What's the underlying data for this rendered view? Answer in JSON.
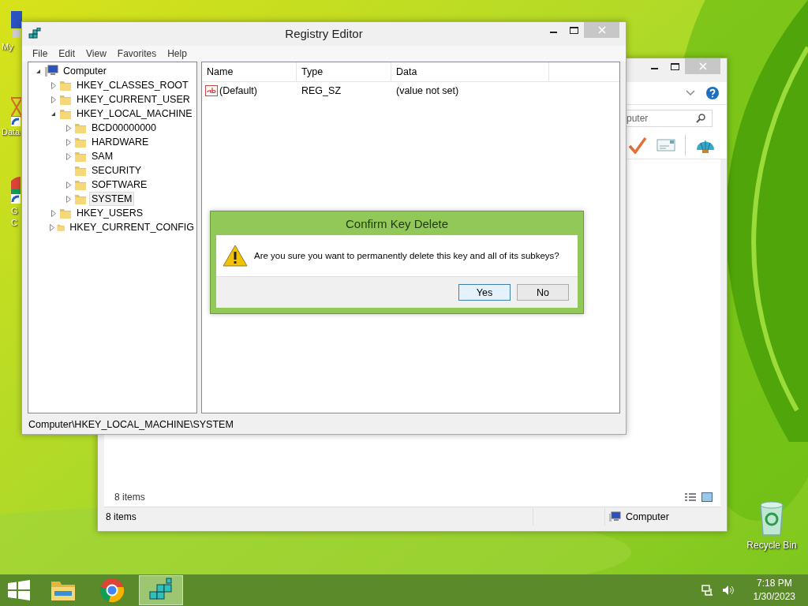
{
  "desktop_icons": [
    {
      "kind": "computer",
      "lines": [
        "My"
      ]
    },
    {
      "kind": "data",
      "lines": [
        "Data"
      ]
    },
    {
      "kind": "chrome",
      "lines": [
        "G",
        "C"
      ]
    }
  ],
  "recycle_bin": {
    "label": "Recycle Bin"
  },
  "explorer": {
    "search": {
      "value": "puter"
    },
    "item_count": "8 items",
    "status": {
      "count": "8 items",
      "location": "Computer"
    }
  },
  "registry_editor": {
    "title": "Registry Editor",
    "menu": [
      "File",
      "Edit",
      "View",
      "Favorites",
      "Help"
    ],
    "tree": [
      {
        "label": "Computer",
        "kind": "computer",
        "expanded": true,
        "selected": false,
        "children": [
          {
            "label": "HKEY_CLASSES_ROOT",
            "kind": "folder",
            "expanded": false,
            "selected": false
          },
          {
            "label": "HKEY_CURRENT_USER",
            "kind": "folder",
            "expanded": false,
            "selected": false
          },
          {
            "label": "HKEY_LOCAL_MACHINE",
            "kind": "folder",
            "expanded": true,
            "selected": false,
            "children": [
              {
                "label": "BCD00000000",
                "kind": "folder",
                "expanded": false,
                "selected": false
              },
              {
                "label": "HARDWARE",
                "kind": "folder",
                "expanded": false,
                "selected": false
              },
              {
                "label": "SAM",
                "kind": "folder",
                "expanded": false,
                "selected": false
              },
              {
                "label": "SECURITY",
                "kind": "folder",
                "selected": false
              },
              {
                "label": "SOFTWARE",
                "kind": "folder",
                "expanded": false,
                "selected": false
              },
              {
                "label": "SYSTEM",
                "kind": "folder",
                "expanded": false,
                "selected": true
              }
            ]
          },
          {
            "label": "HKEY_USERS",
            "kind": "folder",
            "expanded": false,
            "selected": false
          },
          {
            "label": "HKEY_CURRENT_CONFIG",
            "kind": "folder",
            "expanded": false,
            "selected": false
          }
        ]
      }
    ],
    "columns": [
      "Name",
      "Type",
      "Data"
    ],
    "rows": [
      {
        "name": "(Default)",
        "type": "REG_SZ",
        "data": "(value not set)"
      }
    ],
    "status_bar": "Computer\\HKEY_LOCAL_MACHINE\\SYSTEM"
  },
  "dialog": {
    "title": "Confirm Key Delete",
    "message": "Are you sure you want to permanently delete this key and all of its subkeys?",
    "buttons": [
      {
        "label": "Yes",
        "default": true
      },
      {
        "label": "No",
        "default": false
      }
    ]
  },
  "taskbar": {
    "apps": [
      {
        "kind": "explorer",
        "active": false
      },
      {
        "kind": "chrome",
        "active": false
      },
      {
        "kind": "regedit",
        "active": true
      }
    ],
    "time": "7:18 PM",
    "date": "1/30/2023"
  }
}
